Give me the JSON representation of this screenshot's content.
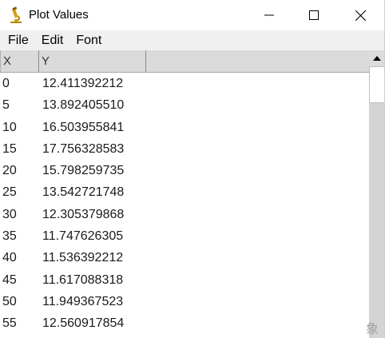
{
  "window": {
    "title": "Plot Values",
    "icon": "microscope-icon"
  },
  "menu": {
    "items": [
      "File",
      "Edit",
      "Font"
    ]
  },
  "table": {
    "columns": [
      "X",
      "Y"
    ],
    "rows": [
      [
        "0",
        "12.411392212"
      ],
      [
        "5",
        "13.892405510"
      ],
      [
        "10",
        "16.503955841"
      ],
      [
        "15",
        "17.756328583"
      ],
      [
        "20",
        "15.798259735"
      ],
      [
        "25",
        "13.542721748"
      ],
      [
        "30",
        "12.305379868"
      ],
      [
        "35",
        "11.747626305"
      ],
      [
        "40",
        "11.536392212"
      ],
      [
        "45",
        "11.617088318"
      ],
      [
        "50",
        "11.949367523"
      ],
      [
        "55",
        "12.560917854"
      ]
    ]
  },
  "ime_indicator": "象"
}
